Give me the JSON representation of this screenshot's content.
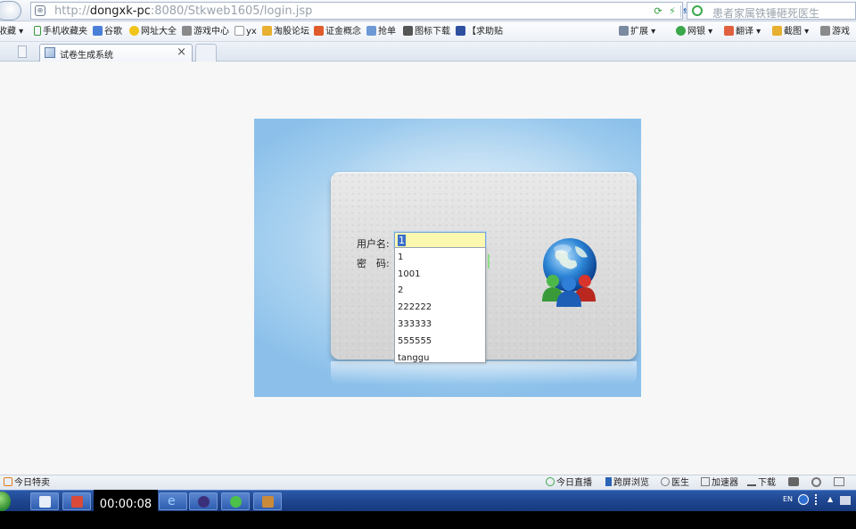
{
  "browser": {
    "url_prefix": "http://",
    "url_host": "dongxk-pc",
    "url_path": ":8080/Stkweb1605/login.jsp",
    "search_placeholder": "患者家属铁锤砸死医生",
    "lock_glyph": "⊕",
    "tool_icons": [
      "refresh-icon",
      "bolt-icon",
      "compat-icon",
      "dropdown-icon"
    ]
  },
  "favorites": {
    "items": [
      {
        "label": "收藏 ▾"
      },
      {
        "label": "手机收藏夹"
      },
      {
        "label": "谷歌"
      },
      {
        "label": "网址大全"
      },
      {
        "label": "游戏中心"
      },
      {
        "label": "yx"
      },
      {
        "label": "淘股论坛"
      },
      {
        "label": "证金概念"
      },
      {
        "label": "抢单"
      },
      {
        "label": "图标下载"
      },
      {
        "label": "【求助贴"
      }
    ],
    "right_items": [
      {
        "label": "扩展 ▾"
      },
      {
        "label": "网银 ▾"
      },
      {
        "label": "翻译 ▾"
      },
      {
        "label": "截图 ▾"
      },
      {
        "label": "游戏"
      }
    ]
  },
  "tabs": {
    "active_title": "试卷生成系统",
    "close_glyph": "×"
  },
  "login": {
    "username_label": "用户名:",
    "password_label": "密　码:",
    "username_value": "1",
    "suggestions": [
      "1",
      "1001",
      "2",
      "222222",
      "333333",
      "555555",
      "tanggu"
    ]
  },
  "status_bar": {
    "left_label": "今日特卖",
    "items": [
      "今日直播",
      "跨屏浏览",
      "医生",
      "加速器",
      "下载"
    ]
  },
  "taskbar": {
    "timer": "00:00:08",
    "tray_lang": "EN"
  },
  "colors": {
    "login_bg": "#bcdcf3",
    "input_highlight": "#fdf8b0",
    "taskbar": "#1f4690"
  }
}
